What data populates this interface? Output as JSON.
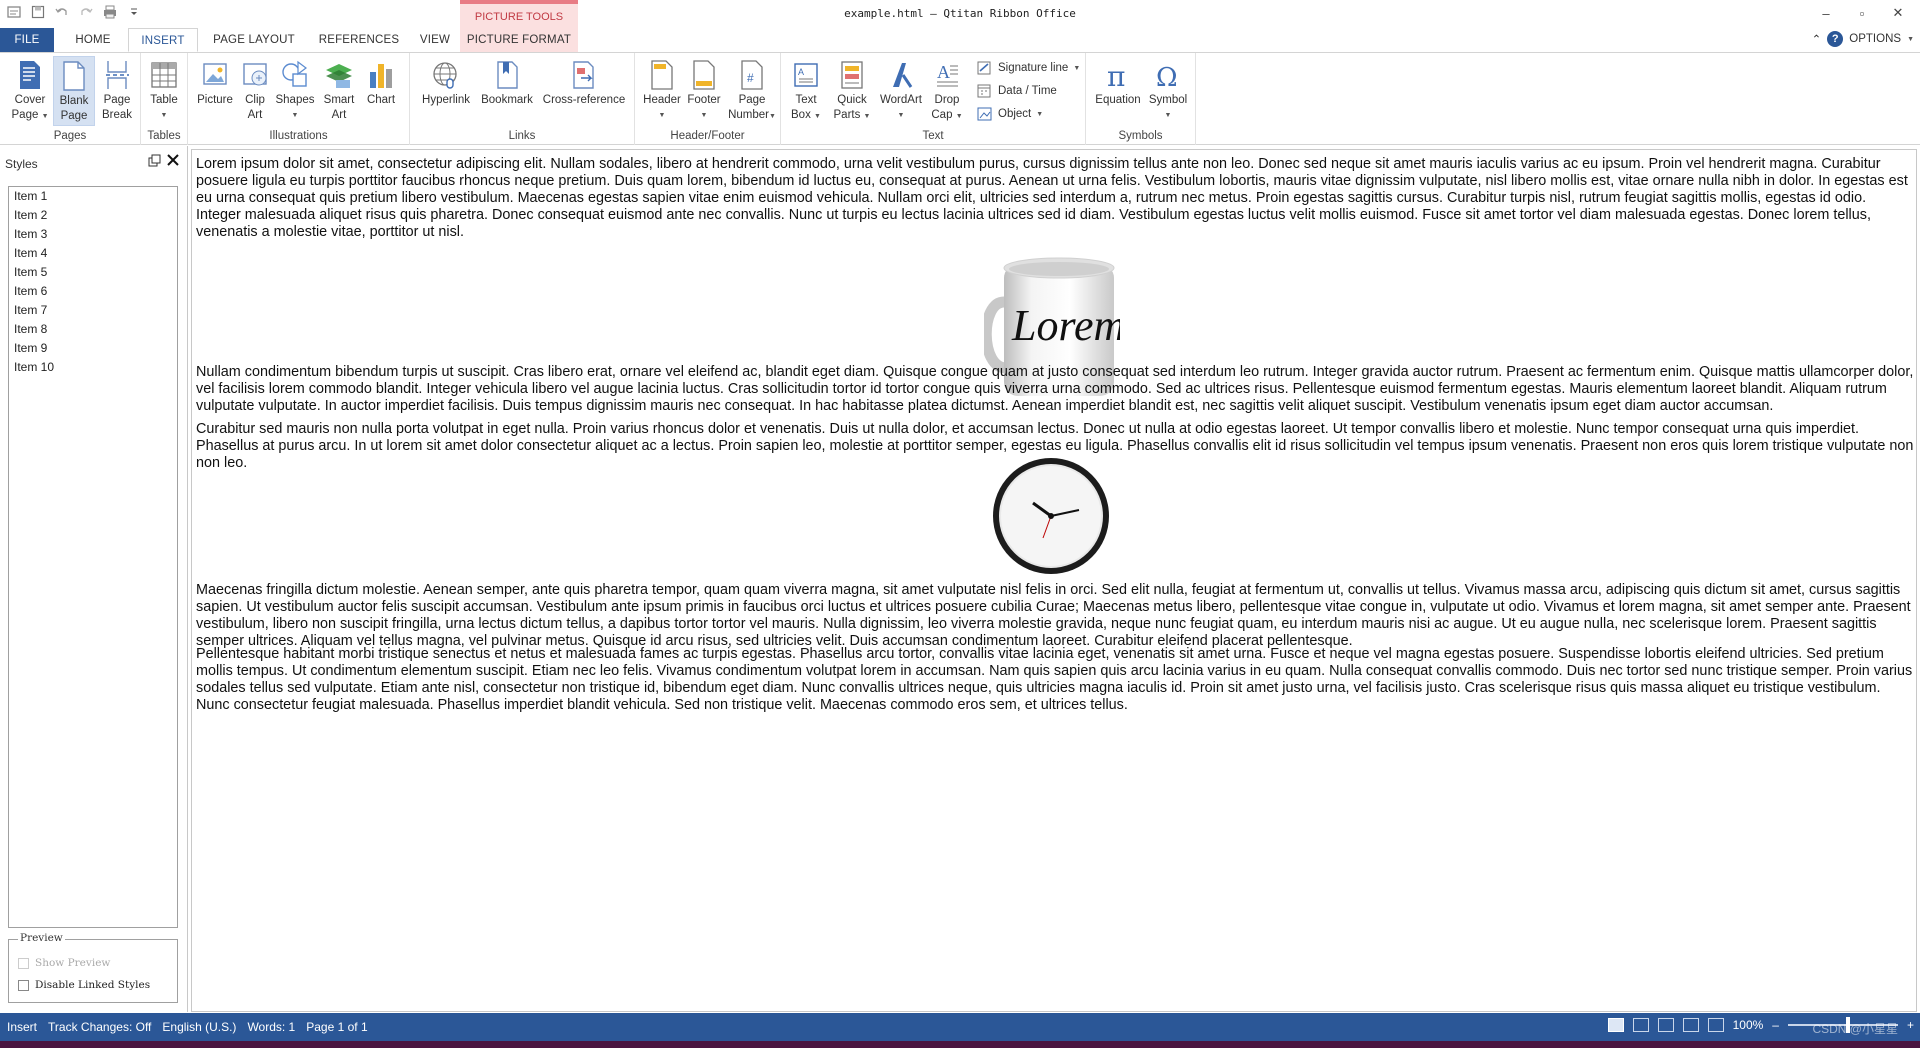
{
  "window": {
    "title": "example.html – Qtitan Ribbon Office",
    "context_tools": "PICTURE TOOLS",
    "controls": [
      "–",
      "▫",
      "✕"
    ]
  },
  "qat_icons": [
    "app-icon",
    "save-icon",
    "undo-icon",
    "redo-icon",
    "print-icon",
    "customize-icon"
  ],
  "tabs": [
    "FILE",
    "HOME",
    "INSERT",
    "PAGE LAYOUT",
    "REFERENCES",
    "VIEW",
    "PICTURE FORMAT"
  ],
  "active_tab": "INSERT",
  "options": {
    "caret": "⌃",
    "label": "OPTIONS"
  },
  "ribbon": {
    "pages": {
      "label": "Pages",
      "cover_l1": "Cover",
      "cover_l2": "Page",
      "blank_l1": "Blank",
      "blank_l2": "Page",
      "break_l1": "Page",
      "break_l2": "Break"
    },
    "tables": {
      "label": "Tables",
      "table": "Table"
    },
    "illustrations": {
      "label": "Illustrations",
      "picture": "Picture",
      "clip_l1": "Clip",
      "clip_l2": "Art",
      "shapes": "Shapes",
      "smart_l1": "Smart",
      "smart_l2": "Art",
      "chart": "Chart"
    },
    "links": {
      "label": "Links",
      "hyperlink": "Hyperlink",
      "bookmark": "Bookmark",
      "crossref": "Cross-reference"
    },
    "header_footer": {
      "label": "Header/Footer",
      "header": "Header",
      "footer": "Footer",
      "pagenum_l1": "Page",
      "pagenum_l2": "Number"
    },
    "text": {
      "label": "Text",
      "textbox_l1": "Text",
      "textbox_l2": "Box",
      "quick_l1": "Quick",
      "quick_l2": "Parts",
      "wordart": "WordArt",
      "drop_l1": "Drop",
      "drop_l2": "Cap",
      "signature": "Signature line",
      "datetime": "Data / Time",
      "object": "Object"
    },
    "symbols": {
      "label": "Symbols",
      "equation": "Equation",
      "symbol": "Symbol"
    }
  },
  "styles_pane": {
    "title": "Styles",
    "items": [
      "Item 1",
      "Item 2",
      "Item 3",
      "Item 4",
      "Item 5",
      "Item 6",
      "Item 7",
      "Item 8",
      "Item 9",
      "Item 10"
    ],
    "preview_legend": "Preview",
    "show_preview": "Show Preview",
    "disable_linked": "Disable Linked Styles"
  },
  "document": {
    "p1": "Lorem ipsum dolor sit amet, consectetur adipiscing elit. Nullam sodales, libero at hendrerit commodo, urna velit vestibulum purus, cursus dignissim tellus ante non leo. Donec sed neque sit amet mauris iaculis varius ac eu ipsum. Proin vel hendrerit magna. Curabitur posuere ligula eu turpis porttitor faucibus rhoncus neque pretium. Duis quam lorem, bibendum id luctus eu, consequat at purus. Aenean ut urna felis. Vestibulum lobortis, mauris vitae dignissim vulputate, nisl libero mollis est, vitae ornare nulla nibh in dolor. In egestas est eu urna consequat quis pretium libero vestibulum. Maecenas egestas sapien vitae enim euismod vehicula. Nullam orci elit, ultricies sed interdum a, rutrum nec metus. Proin egestas sagittis cursus. Curabitur turpis nisl, rutrum feugiat sagittis mollis, egestas id odio. Integer malesuada aliquet risus quis pharetra. Donec consequat euismod ante nec convallis. Nunc ut turpis eu lectus lacinia ultrices sed id diam. Vestibulum egestas luctus velit mollis euismod. Fusce sit amet tortor vel diam malesuada egestas. Donec lorem tellus, venenatis a molestie vitae, porttitor ut nisl.",
    "mug_text": "Lorem",
    "p2": "Nullam condimentum bibendum turpis ut suscipit. Cras libero erat, ornare vel eleifend ac, blandit eget diam. Quisque congue quam at justo consequat sed interdum leo rutrum. Integer gravida auctor rutrum. Praesent ac fermentum enim. Quisque mattis ullamcorper dolor, vel facilisis lorem commodo blandit. Integer vehicula libero vel augue lacinia luctus. Cras sollicitudin tortor id tortor congue quis viverra urna commodo. Sed ac ultrices risus. Pellentesque euismod fermentum egestas. Mauris elementum laoreet blandit. Aliquam rutrum vulputate vulputate. In auctor imperdiet facilisis. Duis tempus dignissim mauris nec consequat. In hac habitasse platea dictumst. Aenean imperdiet blandit est, nec sagittis velit aliquet suscipit. Vestibulum venenatis ipsum eget diam auctor accumsan.",
    "p3": "Curabitur sed mauris non nulla porta volutpat in eget nulla. Proin varius rhoncus dolor et venenatis. Duis ut nulla dolor, et accumsan lectus. Donec ut nulla at odio egestas laoreet. Ut tempor convallis libero et molestie. Nunc tempor consequat urna quis imperdiet. Phasellus at purus arcu. In ut lorem sit amet dolor consectetur aliquet ac a lectus. Proin sapien leo, molestie at porttitor semper, egestas eu ligula. Phasellus convallis elit id risus sollicitudin vel tempus ipsum venenatis. Praesent non eros quis lorem tristique vulputate non non leo.",
    "p4": "Maecenas fringilla dictum molestie. Aenean semper, ante quis pharetra tempor, quam quam viverra magna, sit amet vulputate nisl felis in orci. Sed elit nulla, feugiat at fermentum ut, convallis ut tellus. Vivamus massa arcu, adipiscing quis dictum sit amet, cursus sagittis sapien. Ut vestibulum auctor felis suscipit accumsan. Vestibulum ante ipsum primis in faucibus orci luctus et ultrices posuere cubilia Curae; Maecenas metus libero, pellentesque vitae congue in, vulputate ut odio. Vivamus et lorem magna, sit amet semper ante. Praesent vestibulum, libero non suscipit fringilla, urna lectus dictum tellus, a dapibus tortor tortor vel mauris. Nulla dignissim, leo viverra molestie gravida, neque nunc feugiat quam, eu interdum mauris nisi ac augue. Ut eu augue nulla, nec scelerisque lorem. Praesent sagittis semper ultrices. Aliquam vel tellus magna, vel pulvinar metus. Quisque id arcu risus, sed ultricies velit. Duis accumsan condimentum laoreet. Curabitur eleifend placerat pellentesque.",
    "p5": "Pellentesque habitant morbi tristique senectus et netus et malesuada fames ac turpis egestas. Phasellus arcu tortor, convallis vitae lacinia eget, venenatis sit amet urna. Fusce et neque vel magna egestas posuere. Suspendisse lobortis eleifend ultricies. Sed pretium mollis tempus. Ut condimentum elementum suscipit. Etiam nec leo felis. Vivamus condimentum volutpat lorem in accumsan. Nam quis sapien quis arcu lacinia varius in eu quam. Nulla consequat convallis commodo. Duis nec tortor sed nunc tristique semper. Proin varius sodales tellus sed vulputate. Etiam ante nisl, consectetur non tristique id, bibendum eget diam. Nunc convallis ultrices neque, quis ultricies magna iaculis id. Proin sit amet justo urna, vel facilisis justo. Cras scelerisque risus quis massa aliquet eu tristique vestibulum. Nunc consectetur feugiat malesuada. Phasellus imperdiet blandit vehicula. Sed non tristique velit. Maecenas commodo eros sem, et ultrices tellus."
  },
  "statusbar": {
    "mode": "Insert",
    "track_changes": "Track Changes: Off",
    "language": "English (U.S.)",
    "words": "Words: 1",
    "page": "Page 1 of 1",
    "zoom": "100%",
    "zoom_minus": "–",
    "zoom_plus": "+",
    "watermark": "CSDN @小星星"
  },
  "colors": {
    "accent": "#2b5797",
    "context": "#fbe0e0",
    "context_text": "#c13a44"
  }
}
